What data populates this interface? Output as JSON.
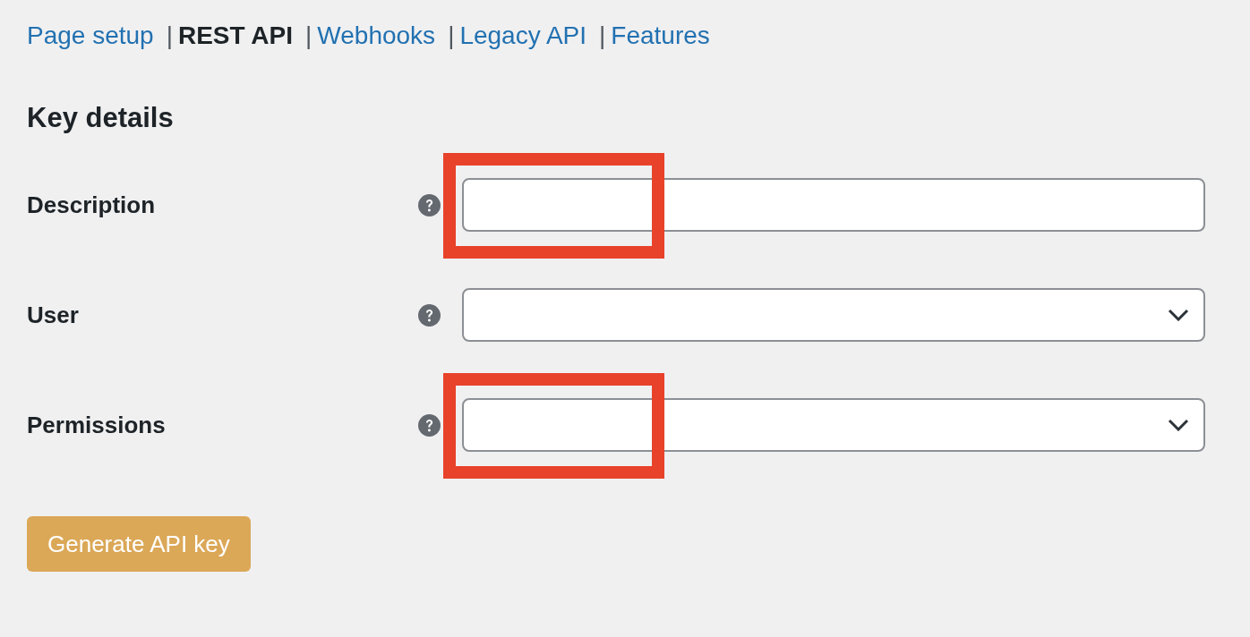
{
  "nav": {
    "separator": "|",
    "tabs": [
      {
        "label": "Page setup",
        "selected": false
      },
      {
        "label": "REST API",
        "selected": true
      },
      {
        "label": "Webhooks",
        "selected": false
      },
      {
        "label": "Legacy API",
        "selected": false
      },
      {
        "label": "Features",
        "selected": false
      }
    ]
  },
  "heading": "Key details",
  "fields": [
    {
      "label": "Description",
      "kind": "text",
      "highlighted": true
    },
    {
      "label": "User",
      "kind": "select",
      "highlighted": false
    },
    {
      "label": "Permissions",
      "kind": "select",
      "highlighted": true
    }
  ],
  "button": "Generate API key"
}
